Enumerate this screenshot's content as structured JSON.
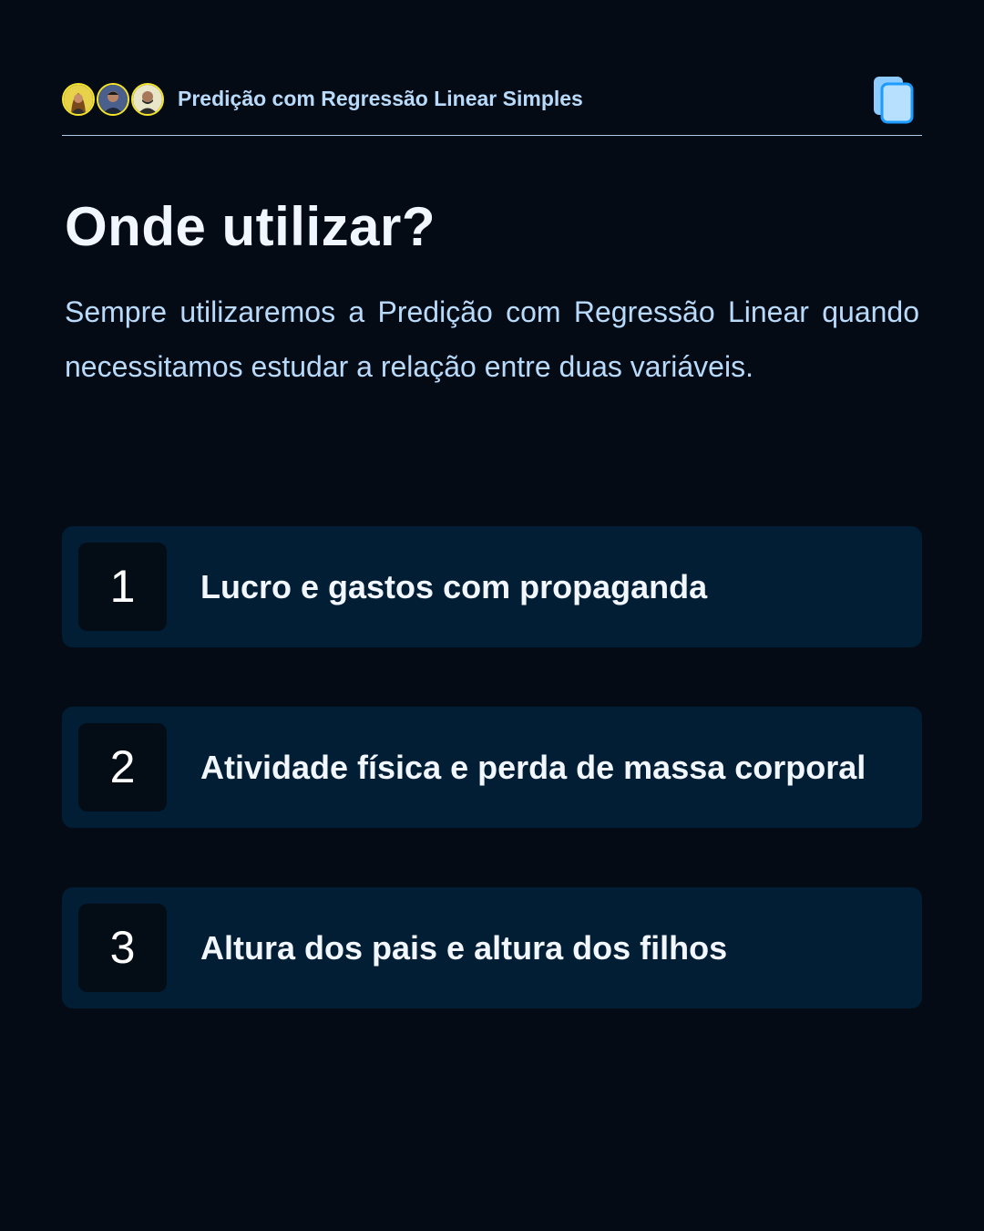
{
  "header": {
    "title": "Predição com Regressão Linear Simples",
    "avatars": [
      "avatar-1",
      "avatar-2",
      "avatar-3"
    ],
    "action_icon": "copy-icon"
  },
  "main": {
    "title": "Onde utilizar?",
    "intro": "Sempre utilizaremos a Predição com Regressão Linear quando necessitamos estudar a relação entre duas variáveis.",
    "items": [
      {
        "number": "1",
        "label": "Lucro e gastos com propaganda"
      },
      {
        "number": "2",
        "label": "Atividade física e perda de massa corporal"
      },
      {
        "number": "3",
        "label": "Altura dos pais e altura dos filhos"
      }
    ]
  },
  "colors": {
    "background": "#050b15",
    "accent": "#b9dbfb",
    "card": "#011e35",
    "avatar_ring": "#f5e52a",
    "icon": "#4db3ff"
  }
}
